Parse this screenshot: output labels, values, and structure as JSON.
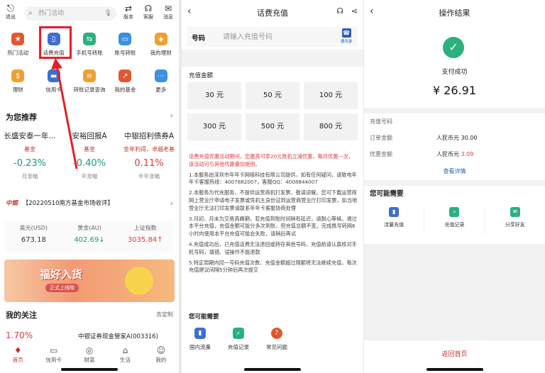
{
  "panel1": {
    "top": {
      "logout": "退出",
      "search_placeholder": "热门活动",
      "version": "版本",
      "service": "客服",
      "messages": "消息"
    },
    "grid_row1": [
      "热门活动",
      "话费充值",
      "手机号转账",
      "账号转账",
      "我的理财"
    ],
    "grid_row2": [
      "理财",
      "信用卡",
      "转账记录查询",
      "我的基金",
      "更多"
    ],
    "recommend_title": "为您推荐",
    "funds": [
      {
        "name": "长盛安泰一年...",
        "tag": "基金",
        "value": "-0.23%",
        "label": "月涨幅"
      },
      {
        "name": "安裕回报A",
        "tag": "基金",
        "value": "-0.40%",
        "label": "年涨幅"
      },
      {
        "name": "中银招利债券A",
        "tag": "金年利得，卓越老基",
        "value": "0.11%",
        "label": "半年涨幅"
      }
    ],
    "news_logo": "中银",
    "news_text": "【20220510南方基金市场收评】",
    "market": [
      {
        "label": "美元(USD)",
        "value": "673.18"
      },
      {
        "label": "黄金(AU)",
        "value": "402.69↓"
      },
      {
        "label": "上证指数",
        "value": "3035.84↑"
      }
    ],
    "banner_title": "福好入货",
    "banner_sub": "正式上线啦",
    "focus_title": "我的关注",
    "focus_custom": "去定制",
    "focus_pct": "1.70%",
    "focus_fund": "中银证券现金管家A(003316)",
    "tabs": [
      "首页",
      "信用卡",
      "财富",
      "生活",
      "我的"
    ]
  },
  "panel2": {
    "title": "话费充值",
    "phone_label": "号码",
    "phone_placeholder": "请输入充值号码",
    "contacts_label": "通讯录",
    "amount_title": "充值金额",
    "amounts": [
      "30 元",
      "50 元",
      "100 元",
      "300 元",
      "500 元",
      "800 元"
    ],
    "promo": "话费充值优惠活动期间，您最高可享20元账机立减优惠，每月优惠一次，该活动可与其他优惠叠加使用。",
    "rules": [
      "1.本服务由深圳市年年卡网络科技有限公司提供，如有任何疑问，请致电年年卡客服热线：4007882007，客服QQ：4008844007",
      "2.本服务为代充服务，不提供运营商机打发票，敬请谅解。您可下载运营商网上营业厅申请电子发票或凭机主身份证到运营商营业厅打印发票，如当地营业厅无法打印发票请联系年年卡客服协商处理",
      "3.月初、月末为交易高峰期，若充值到账时间稍有延迟，请耐心等候。通过本平台充值，充值金额可能分多次到账，但充值总额不变。完成携号转网6小时内使用本平台充值可能会失败，请稍后再试",
      "4.充值成功后，已充值话费无法退回或转存其他号码，充值前请认真核对手机号码，填错、误操作不能退款",
      "5.特定周期内同一号码充值次数、充值金额超过限额将无法继续充值，每次充值建议间隔5分钟后再次提交"
    ],
    "need_title": "您可能需要",
    "actions": [
      "国内流量",
      "充值记录",
      "常见问题"
    ]
  },
  "panel3": {
    "title": "操作结果",
    "status": "支付成功",
    "amount": "¥ 26.91",
    "phone_label": "充值号码",
    "order_label": "订单金额",
    "order_value": "人民币元 30.00",
    "discount_label": "优惠金额",
    "discount_prefix": "人民币元 ",
    "discount_value": "3.09",
    "detail_link": "查看详情",
    "need_title": "您可能需要",
    "actions": [
      "流量充值",
      "充值记录",
      "分享好友"
    ],
    "back_home": "返回首页"
  },
  "colors": {
    "accent_red": "#e41e26",
    "brand_red": "#c0392b",
    "green": "#1a9e6e",
    "success": "#2bb07f",
    "link_blue": "#2d5fb8"
  }
}
